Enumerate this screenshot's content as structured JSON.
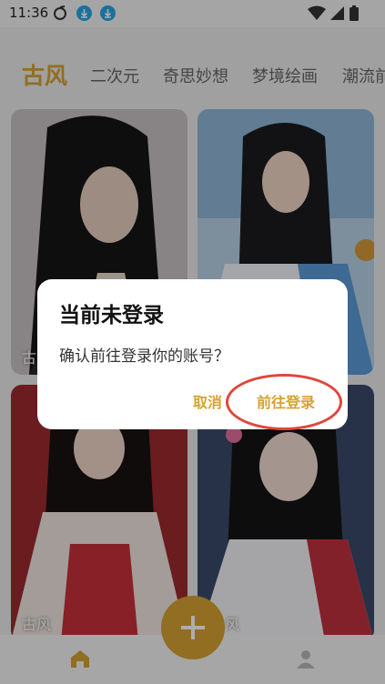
{
  "status_bar": {
    "time": "11:36"
  },
  "tabs": [
    {
      "label": "古风",
      "active": true
    },
    {
      "label": "二次元",
      "active": false
    },
    {
      "label": "奇思妙想",
      "active": false
    },
    {
      "label": "梦境绘画",
      "active": false
    },
    {
      "label": "潮流前",
      "active": false
    }
  ],
  "cards": [
    {
      "label": "古"
    },
    {
      "label": ""
    },
    {
      "label": "古风"
    },
    {
      "label": "风"
    }
  ],
  "dialog": {
    "title": "当前未登录",
    "message": "确认前往登录你的账号？",
    "cancel": "取消",
    "confirm": "前往登录"
  },
  "bottom_nav": {
    "items": [
      "home-icon",
      "create-button",
      "profile-icon"
    ]
  },
  "colors": {
    "accent": "#d6a232",
    "highlight_circle": "#e0463a"
  }
}
